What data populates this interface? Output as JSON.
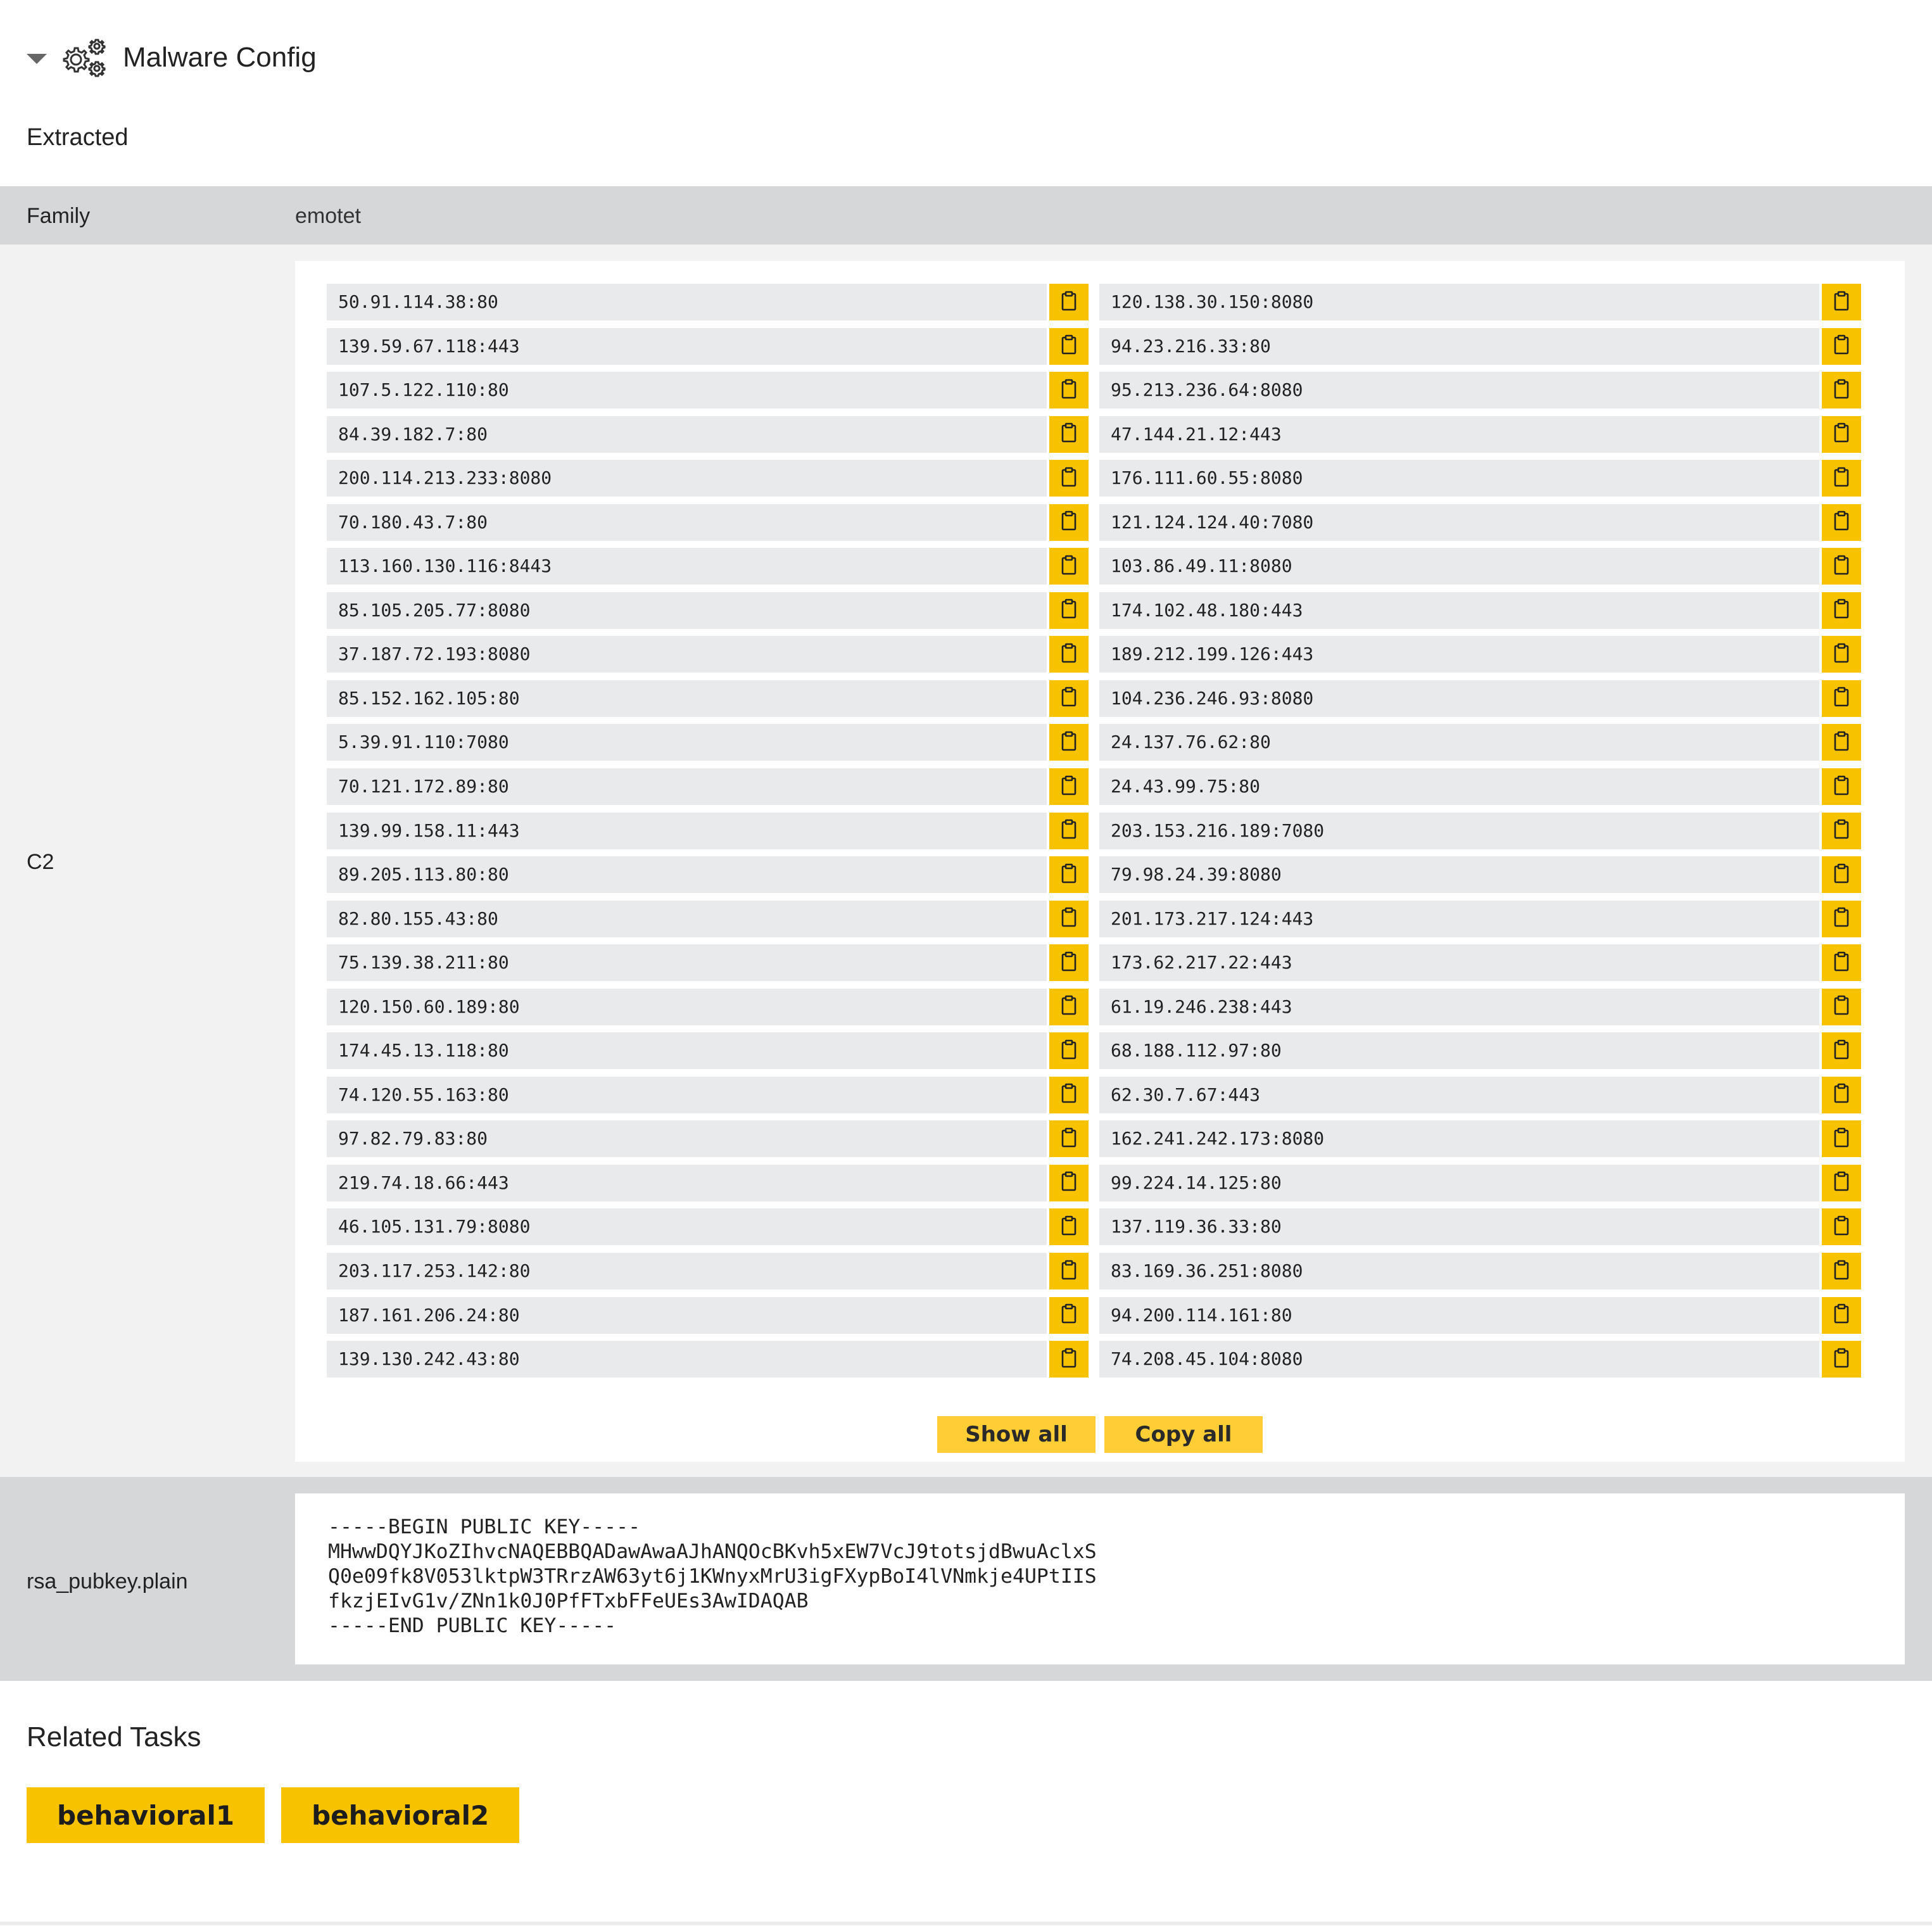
{
  "header": {
    "title": "Malware Config"
  },
  "section": {
    "extracted_label": "Extracted"
  },
  "family": {
    "label": "Family",
    "value": "emotet"
  },
  "c2": {
    "label": "C2",
    "left": [
      "50.91.114.38:80",
      "139.59.67.118:443",
      "107.5.122.110:80",
      "84.39.182.7:80",
      "200.114.213.233:8080",
      "70.180.43.7:80",
      "113.160.130.116:8443",
      "85.105.205.77:8080",
      "37.187.72.193:8080",
      "85.152.162.105:80",
      "5.39.91.110:7080",
      "70.121.172.89:80",
      "139.99.158.11:443",
      "89.205.113.80:80",
      "82.80.155.43:80",
      "75.139.38.211:80",
      "120.150.60.189:80",
      "174.45.13.118:80",
      "74.120.55.163:80",
      "97.82.79.83:80",
      "219.74.18.66:443",
      "46.105.131.79:8080",
      "203.117.253.142:80",
      "187.161.206.24:80",
      "139.130.242.43:80"
    ],
    "right": [
      "120.138.30.150:8080",
      "94.23.216.33:80",
      "95.213.236.64:8080",
      "47.144.21.12:443",
      "176.111.60.55:8080",
      "121.124.124.40:7080",
      "103.86.49.11:8080",
      "174.102.48.180:443",
      "189.212.199.126:443",
      "104.236.246.93:8080",
      "24.137.76.62:80",
      "24.43.99.75:80",
      "203.153.216.189:7080",
      "79.98.24.39:8080",
      "201.173.217.124:443",
      "173.62.217.22:443",
      "61.19.246.238:443",
      "68.188.112.97:80",
      "62.30.7.67:443",
      "162.241.242.173:8080",
      "99.224.14.125:80",
      "137.119.36.33:80",
      "83.169.36.251:8080",
      "94.200.114.161:80",
      "74.208.45.104:8080"
    ],
    "show_all": "Show all",
    "copy_all": "Copy all"
  },
  "rsa": {
    "label": "rsa_pubkey.plain",
    "value": "-----BEGIN PUBLIC KEY-----\nMHwwDQYJKoZIhvcNAQEBBQADawAwaAJhANQOcBKvh5xEW7VcJ9totsjdBwuAclxS\nQ0e09fk8V053lktpW3TRrzAW63yt6j1KWnyxMrU3igFXypBoI4lVNmkje4UPtIIS\nfkzjEIvG1v/ZNn1k0J0PfFTxbFFeUEs3AwIDAQAB\n-----END PUBLIC KEY-----"
  },
  "related": {
    "title": "Related Tasks",
    "tasks": [
      "behavioral1",
      "behavioral2"
    ]
  },
  "icons": {
    "config": "gears-icon",
    "copy": "clipboard-icon",
    "toggle": "caret-down-icon"
  },
  "colors": {
    "accent": "#f7c300",
    "row_alt": "#d6d7d9"
  }
}
